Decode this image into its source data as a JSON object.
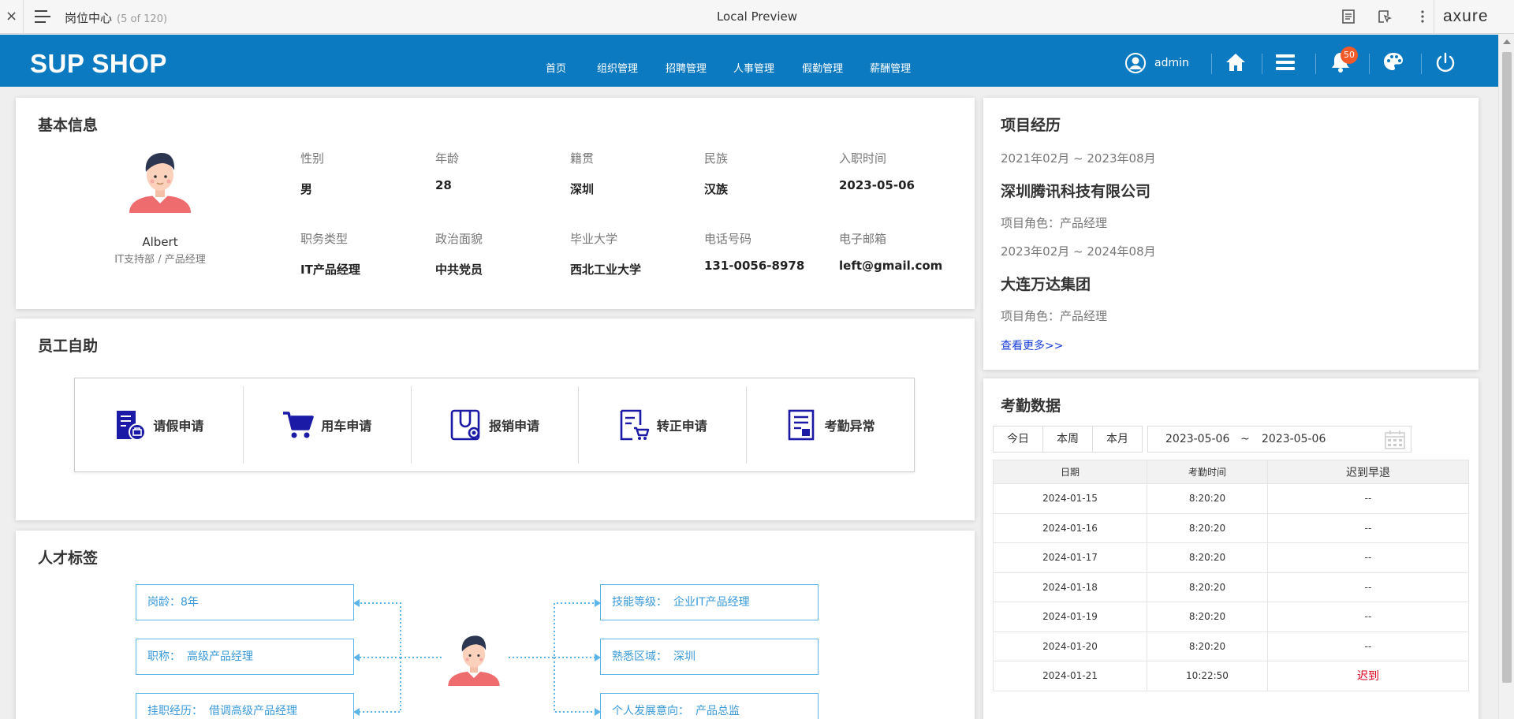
{
  "axure": {
    "close": "×",
    "page_name": "岗位中心",
    "page_count": "(5 of 120)",
    "title": "Local Preview",
    "logo": "axure"
  },
  "header": {
    "logo": "SUP SHOP",
    "nav": [
      "首页",
      "组织管理",
      "招聘管理",
      "人事管理",
      "假勤管理",
      "薪酬管理"
    ],
    "user": "admin",
    "badge": "50",
    "icons": [
      "user-icon",
      "home-icon",
      "menu-icon",
      "bell-icon",
      "palette-icon",
      "power-icon"
    ],
    "accent": "#0b7ac0"
  },
  "basic": {
    "title": "基本信息",
    "name": "Albert",
    "dept": "IT支持部 / 产品经理",
    "fields": [
      {
        "label": "性别",
        "value": "男"
      },
      {
        "label": "年龄",
        "value": "28"
      },
      {
        "label": "籍贯",
        "value": "深圳"
      },
      {
        "label": "民族",
        "value": "汉族"
      },
      {
        "label": "入职时间",
        "value": "2023-05-06"
      },
      {
        "label": "职务类型",
        "value": "IT产品经理"
      },
      {
        "label": "政治面貌",
        "value": "中共党员"
      },
      {
        "label": "毕业大学",
        "value": "西北工业大学"
      },
      {
        "label": "电话号码",
        "value": "131-0056-8978"
      },
      {
        "label": "电子邮箱",
        "value": "left@gmail.com"
      }
    ]
  },
  "self_service": {
    "title": "员工自助",
    "items": [
      "请假申请",
      "用车申请",
      "报销申请",
      "转正申请",
      "考勤异常"
    ],
    "icon_color": "#1a1aa6"
  },
  "talent": {
    "title": "人才标签",
    "left": [
      {
        "label": "岗龄：",
        "value": "8年"
      },
      {
        "label": "职称：",
        "value": "高级产品经理"
      },
      {
        "label": "挂职经历：",
        "value": "借调高级产品经理"
      }
    ],
    "right": [
      {
        "label": "技能等级：",
        "value": "企业IT产品经理"
      },
      {
        "label": "熟悉区域：",
        "value": "深圳"
      },
      {
        "label": "个人发展意向：",
        "value": "产品总监"
      }
    ],
    "tag_color": "#3a9ad9"
  },
  "projects": {
    "title": "项目经历",
    "list": [
      {
        "period": "2021年02月 ~ 2023年08月",
        "company": "深圳腾讯科技有限公司",
        "role": "项目角色：产品经理"
      },
      {
        "period": "2023年02月 ~ 2024年08月",
        "company": "大连万达集团",
        "role": "项目角色：产品经理"
      }
    ],
    "more": "查看更多>>"
  },
  "attendance": {
    "title": "考勤数据",
    "tabs": [
      "今日",
      "本周",
      "本月"
    ],
    "start": "2023-05-06",
    "sep": "~",
    "end": "2023-05-06",
    "columns": [
      "日期",
      "考勤时间",
      "迟到早退"
    ],
    "rows": [
      [
        "2024-01-15",
        "8:20:20",
        "--"
      ],
      [
        "2024-01-16",
        "8:20:20",
        "--"
      ],
      [
        "2024-01-17",
        "8:20:20",
        "--"
      ],
      [
        "2024-01-18",
        "8:20:20",
        "--"
      ],
      [
        "2024-01-19",
        "8:20:20",
        "--"
      ],
      [
        "2024-01-20",
        "8:20:20",
        "--"
      ],
      [
        "2024-01-21",
        "10:22:50",
        "迟到"
      ]
    ],
    "late_color": "#d9001b"
  }
}
